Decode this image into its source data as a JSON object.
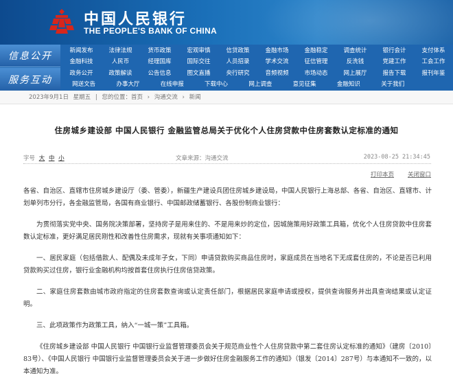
{
  "brand": {
    "name_cn": "中国人民银行",
    "name_en": "THE PEOPLE'S BANK OF CHINA",
    "accent": "#1f66b0",
    "emblem_color": "#d7261b"
  },
  "nav": {
    "side1": "信息公开",
    "side2": "服务互动",
    "row1": [
      "新闻发布",
      "法律法规",
      "货币政策",
      "宏观审慎",
      "信贷政策",
      "金融市场",
      "金融稳定",
      "调查统计",
      "银行会计",
      "支付体系"
    ],
    "row2": [
      "金融科技",
      "人民币",
      "经理国库",
      "国际交往",
      "人员招录",
      "学术交流",
      "征信管理",
      "反洗钱",
      "党建工作",
      "工会工作"
    ],
    "row3": [
      "政务公开",
      "政策解读",
      "公告信息",
      "图文直播",
      "央行研究",
      "音频视频",
      "市场动态",
      "网上展厅",
      "报告下载",
      "报刊年鉴"
    ],
    "row4": [
      "网送文告",
      "办事大厅",
      "在线申报",
      "下载中心",
      "网上调查",
      "意见征集",
      "金融知识",
      "关于我们"
    ]
  },
  "breadcrumb": {
    "date": "2023年9月1日",
    "weekday": "星期五",
    "location": "您的位置：首页",
    "sep": "›",
    "level2": "沟通交流",
    "level3": "新闻"
  },
  "article": {
    "title": "住房城乡建设部 中国人民银行 金融监管总局关于优化个人住房贷款中住房套数认定标准的通知",
    "font_size_label": "字号",
    "font_sizes": [
      "大",
      "中",
      "小"
    ],
    "source": "文章来源：沟通交流",
    "datetime": "2023-08-25 21:34:45",
    "print": "打印本页",
    "close": "关闭窗口",
    "paragraphs": [
      "各省、自治区、直辖市住房城乡建设厅（委、管委），新疆生产建设兵团住房城乡建设局，中国人民银行上海总部、各省、自治区、直辖市、计划单列市分行，各金融监管局，各国有商业银行、中国邮政储蓄银行、各股份制商业银行：",
      "为贯彻落实党中央、国务院决策部署，坚持房子是用来住的、不是用来炒的定位，因城施策用好政策工具箱，优化个人住房贷款中住房套数认定标准，更好满足居民刚性和改善性住房需求，现就有关事项通知如下：",
      "一、居民家庭（包括借款人、配偶及未成年子女，下同）申请贷款购买商品住房时，家庭成员在当地名下无成套住房的，不论是否已利用贷款购买过住房，银行业金融机构均按首套住房执行住房信贷政策。",
      "二、家庭住房套数由城市政府指定的住房套数查询或认定责任部门，根据居民家庭申请或授权，提供查询服务并出具查询结果或认定证明。",
      "三、此项政策作为政策工具，纳入“一城一策”工具箱。",
      "《住房城乡建设部 中国人民银行 中国银行业监督管理委员会关于规范商业性个人住房贷款中第二套住房认定标准的通知》（建房〔2010〕83号）、《中国人民银行 中国银行业监督管理委员会关于进一步做好住房金融服务工作的通知》（银发〔2014〕287号）与本通知不一致的，以本通知为准。"
    ]
  }
}
